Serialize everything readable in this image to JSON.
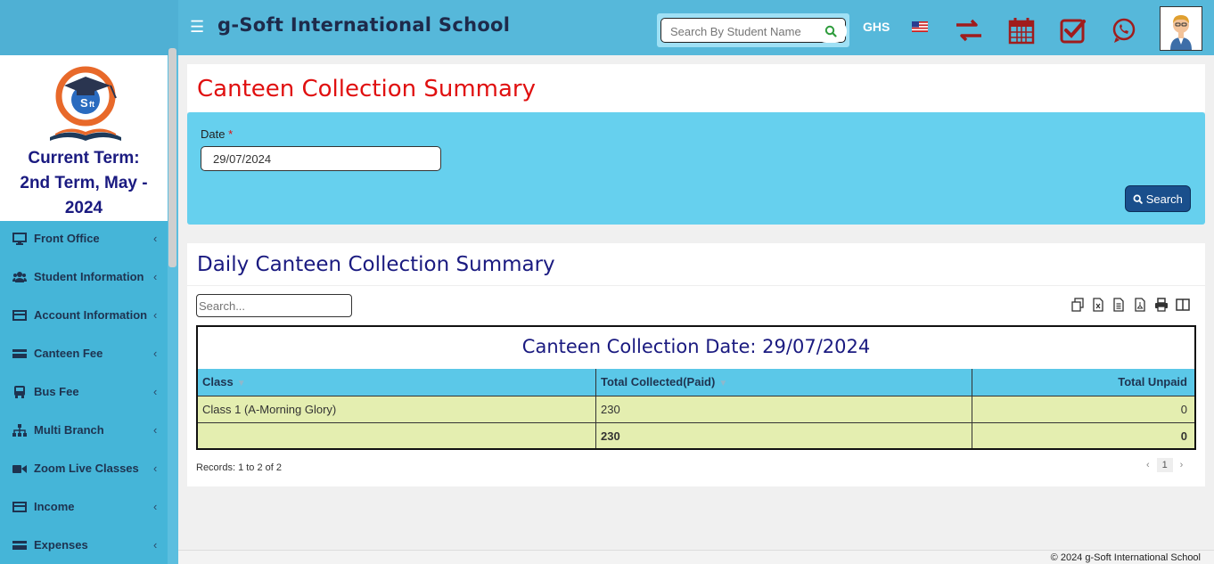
{
  "header": {
    "menu_icon": "hamburger-icon",
    "school_name": "g-Soft International School",
    "search_placeholder": "Search By Student Name",
    "currency": "GHS",
    "flag": "us-flag-icon",
    "icons": [
      "transfer-icon",
      "calendar-icon",
      "checkbox-icon",
      "whatsapp-icon",
      "user-avatar"
    ],
    "accent_color": "#56b8da"
  },
  "sidebar": {
    "term_line1": "Current Term:",
    "term_line2": "2nd Term, May -",
    "term_line3": "2024",
    "items": [
      {
        "label": "Front Office",
        "icon": "monitor-icon"
      },
      {
        "label": "Student Information",
        "icon": "users-icon"
      },
      {
        "label": "Account Information",
        "icon": "card-icon"
      },
      {
        "label": "Canteen Fee",
        "icon": "credit-card-icon"
      },
      {
        "label": "Bus Fee",
        "icon": "bus-icon"
      },
      {
        "label": "Multi Branch",
        "icon": "sitemap-icon"
      },
      {
        "label": "Zoom Live Classes",
        "icon": "video-icon"
      },
      {
        "label": "Income",
        "icon": "card-icon"
      },
      {
        "label": "Expenses",
        "icon": "credit-card-icon"
      }
    ],
    "chevron": "‹"
  },
  "page": {
    "title": "Canteen Collection Summary",
    "title_color": "#e01010"
  },
  "filter": {
    "date_label": "Date",
    "required_mark": "*",
    "date_value": "29/07/2024",
    "search_button": "Search"
  },
  "report": {
    "title": "Daily Canteen Collection Summary",
    "table_search_placeholder": "Search...",
    "tools": [
      "copy-icon",
      "excel-icon",
      "csv-icon",
      "pdf-icon",
      "print-icon",
      "columns-icon"
    ],
    "caption": "Canteen Collection Date: 29/07/2024",
    "columns": [
      "Class",
      "Total Collected(Paid)",
      "Total Unpaid"
    ],
    "rows": [
      [
        "Class 1 (A-Morning Glory)",
        "230",
        "0"
      ]
    ],
    "totals": [
      "",
      "230",
      "0"
    ],
    "records_text": "Records: 1 to 2 of 2",
    "pager_prev": "‹",
    "pager_page": "1",
    "pager_next": "›"
  },
  "footer": {
    "text": "© 2024 g-Soft International School"
  }
}
